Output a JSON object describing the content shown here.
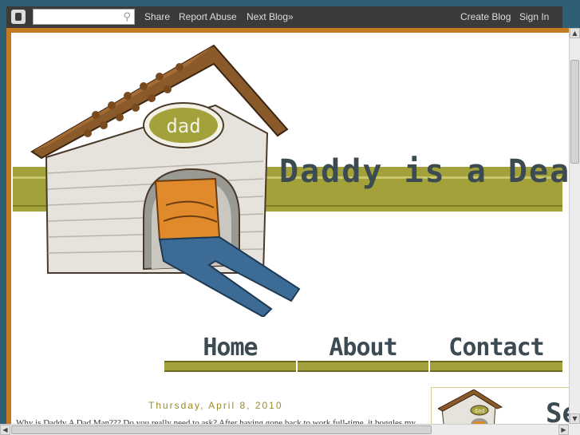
{
  "navbar": {
    "share": "Share",
    "report_abuse": "Report Abuse",
    "next_blog": "Next Blog»",
    "create_blog": "Create Blog",
    "sign_in": "Sign In",
    "search_value": ""
  },
  "header": {
    "blog_title": "Daddy is a Dea",
    "logo_sign": "dad"
  },
  "tabs": [
    {
      "label": "Home"
    },
    {
      "label": "About"
    },
    {
      "label": "Contact"
    }
  ],
  "post": {
    "date": "Thursday, April 8, 2010",
    "snippet": "Why is Daddy A Dad Man??? Do you really need to ask? After having gone back to work full-time, it boggles my"
  },
  "sidebar": {
    "heading_partial": "Se",
    "logo_sign": "dad"
  },
  "colors": {
    "frame": "#c4781f",
    "olive": "#a3a13a",
    "title_text": "#3c4a52",
    "date_text": "#9a8a2a"
  }
}
